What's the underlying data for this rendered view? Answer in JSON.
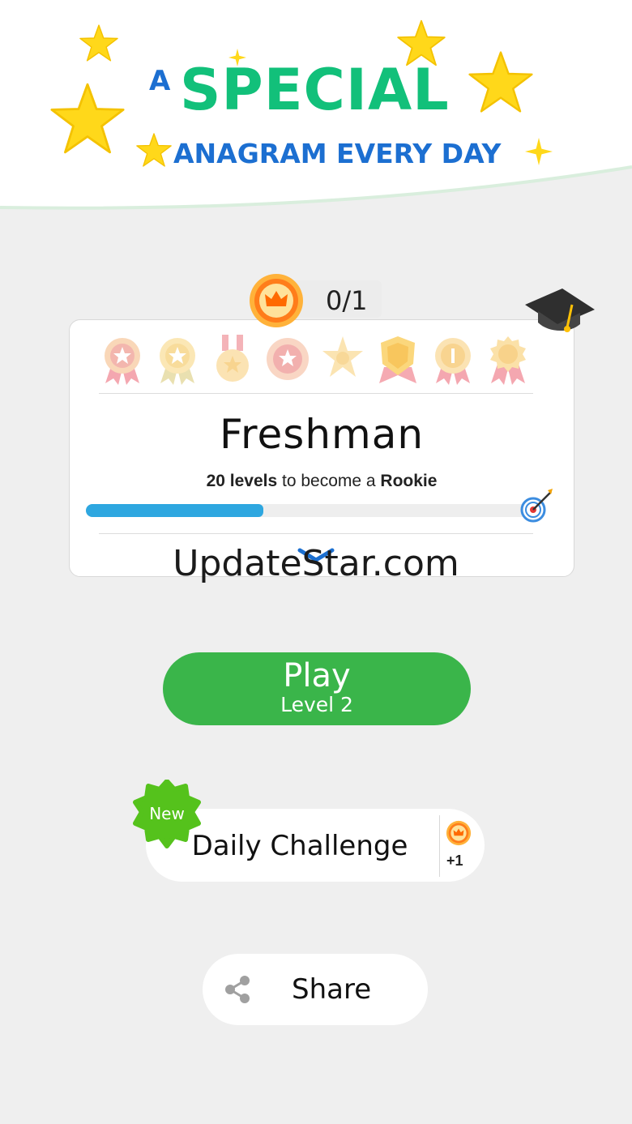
{
  "banner": {
    "title_a": "A",
    "title_main": "SPECIAL",
    "title_sub": "ANAGRAM EVERY DAY"
  },
  "crowns": {
    "count": "0/1",
    "icon": "crown-coin-icon"
  },
  "rank": {
    "title": "Freshman",
    "levels_count": "20 levels",
    "levels_text": " to become a ",
    "next_rank": "Rookie",
    "progress": 0.4,
    "badge_icons": [
      "medal-star",
      "medal-star-gold",
      "medal-ribbon",
      "medal-star-red",
      "sheriff-star",
      "shield-medal",
      "medal-one",
      "medal-seal"
    ]
  },
  "watermark": "UpdateStar.com",
  "play": {
    "label": "Play",
    "sub": "Level 2"
  },
  "daily": {
    "badge": "New",
    "label": "Daily Challenge",
    "reward": "+1"
  },
  "share": {
    "label": "Share"
  },
  "colors": {
    "accent_green": "#3ab54a",
    "title_green": "#12c07a",
    "title_blue": "#1c6fd1",
    "progress_blue": "#2ea7e0",
    "new_badge_green": "#55c21c"
  }
}
